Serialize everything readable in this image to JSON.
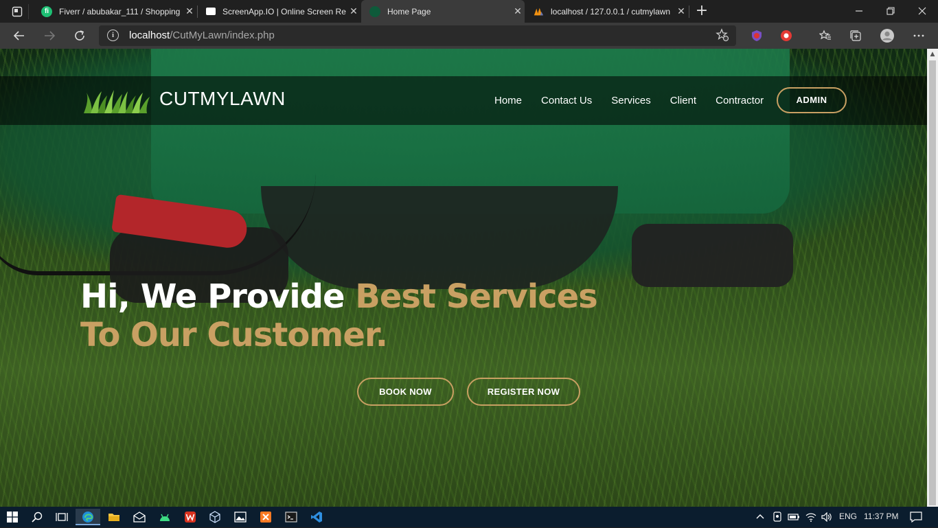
{
  "browser": {
    "tabs": [
      {
        "title": "Fiverr / abubakar_111 / Shopping",
        "icon": "fiverr-icon",
        "color": "#1dbf73"
      },
      {
        "title": "ScreenApp.IO | Online Screen Re",
        "icon": "screenapp-icon",
        "color": "#ffffff"
      },
      {
        "title": "Home Page",
        "icon": "site-icon",
        "color": "#0e5a3a"
      },
      {
        "title": "localhost / 127.0.0.1 / cutmylawn",
        "icon": "phpmyadmin-icon",
        "color": "#f29111"
      }
    ],
    "close_glyph": "✕",
    "new_tab_glyph": "+",
    "address": {
      "host": "localhost",
      "path": "/CutMyLawn/index.php"
    }
  },
  "site": {
    "brand": "CUTMYLAWN",
    "nav": [
      "Home",
      "Contact Us",
      "Services",
      "Client",
      "Contractor"
    ],
    "admin_label": "ADMIN",
    "hero": {
      "line1_white": "Hi, We Provide ",
      "line1_gold": "Best Services",
      "line2_gold": "To Our Customer."
    },
    "book_label": "BOOK NOW",
    "register_label": "REGISTER NOW",
    "accent_color": "#c9a063"
  },
  "taskbar": {
    "language": "ENG",
    "time": "11:37 PM"
  }
}
